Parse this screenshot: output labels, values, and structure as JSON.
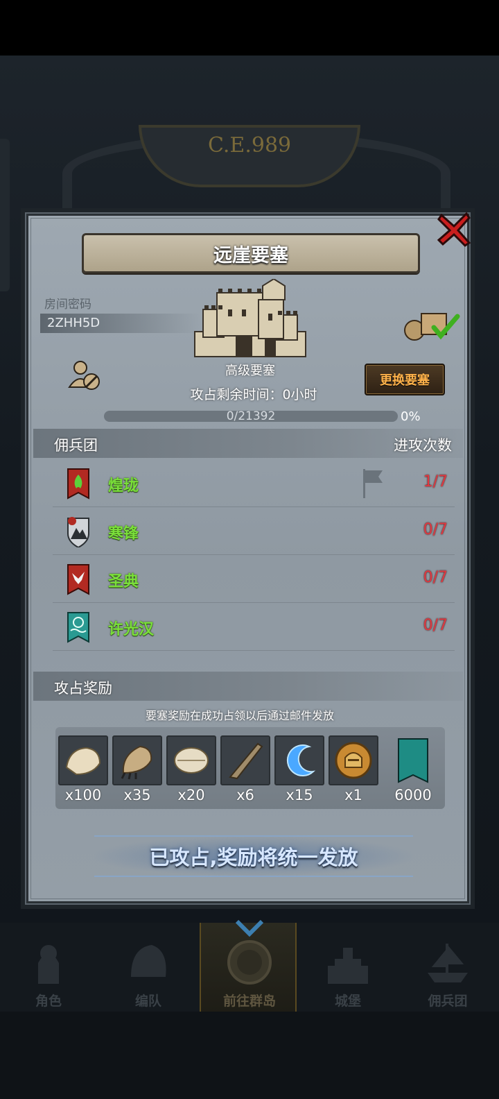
{
  "background": {
    "year": "C.E.989"
  },
  "panel": {
    "title": "远崖要塞",
    "room": {
      "label": "房间密码",
      "code": "2ZHH5D"
    },
    "fortress_type": "高级要塞",
    "time_remaining": "攻占剩余时间：0小时",
    "change_button": "更换要塞",
    "progress": {
      "text": "0/21392",
      "percent_label": "0%",
      "value": 0
    },
    "mercenary_header": {
      "left": "佣兵团",
      "right": "进攻次数"
    },
    "mercenaries": [
      {
        "name": "煌珑",
        "attacks": "1/7",
        "banner_color": "#b22a22",
        "emblem": "flame-emblem"
      },
      {
        "name": "寒锋",
        "attacks": "0/7",
        "banner_color": "#d0d4d8",
        "emblem": "mountain-shield-emblem"
      },
      {
        "name": "圣典",
        "attacks": "0/7",
        "banner_color": "#b22a22",
        "emblem": "bird-emblem"
      },
      {
        "name": "许光汉",
        "attacks": "0/7",
        "banner_color": "#2a9a92",
        "emblem": "wave-emblem"
      }
    ],
    "rewards_header": "攻占奖励",
    "rewards_note": "要塞奖励在成功占领以后通过邮件发放",
    "rewards": [
      {
        "icon": "fur-pelt-icon",
        "qty": "x100"
      },
      {
        "icon": "beast-claw-icon",
        "qty": "x35"
      },
      {
        "icon": "feather-scale-icon",
        "qty": "x20"
      },
      {
        "icon": "horn-icon",
        "qty": "x6"
      },
      {
        "icon": "blue-crescent-icon",
        "qty": "x15"
      },
      {
        "icon": "knight-helmet-medal-icon",
        "qty": "x1"
      },
      {
        "icon": "guild-banner-icon",
        "qty": "6000"
      }
    ],
    "claim_banner": "已攻占,奖励将统一发放"
  },
  "bottom_nav": [
    {
      "label": "角色",
      "icon": "knight-icon"
    },
    {
      "label": "编队",
      "icon": "helmet-icon"
    },
    {
      "label": "前往群岛",
      "icon": "compass-icon",
      "active": true
    },
    {
      "label": "城堡",
      "icon": "castle-icon"
    },
    {
      "label": "佣兵团",
      "icon": "ship-icon"
    }
  ]
}
